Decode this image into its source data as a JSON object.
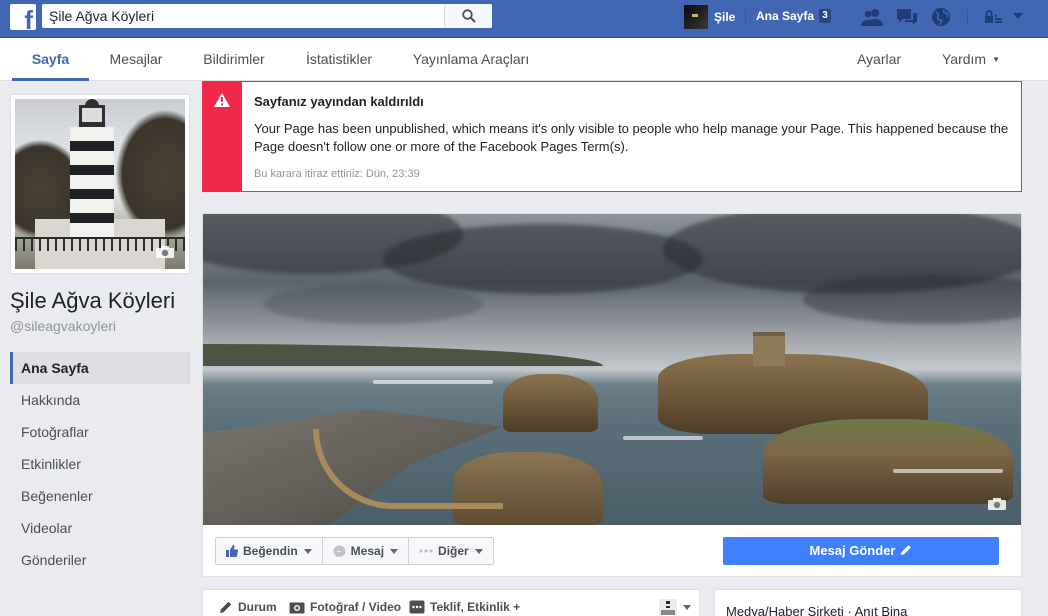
{
  "topbar": {
    "logo_letter": "f",
    "search": {
      "value": "Şile Ağva Köyleri",
      "placeholder": ""
    },
    "profile_name": "Şile",
    "home_label": "Ana Sayfa",
    "home_badge": "3",
    "icons": [
      "friends-icon",
      "messages-icon",
      "globe-icon",
      "lock-icon",
      "chevron-down-icon"
    ],
    "brand_color": "#4267b2"
  },
  "page_nav": {
    "tabs": [
      {
        "label": "Sayfa",
        "active": true
      },
      {
        "label": "Mesajlar"
      },
      {
        "label": "Bildirimler"
      },
      {
        "label": "İstatistikler"
      },
      {
        "label": "Yayınlama Araçları"
      }
    ],
    "right": {
      "settings_label": "Ayarlar",
      "help_label": "Yardım"
    }
  },
  "sidebar": {
    "page_name": "Şile Ağva Köyleri",
    "handle": "@sileagvakoyleri",
    "items": [
      {
        "label": "Ana Sayfa",
        "active": true
      },
      {
        "label": "Hakkında"
      },
      {
        "label": "Fotoğraflar"
      },
      {
        "label": "Etkinlikler"
      },
      {
        "label": "Beğenenler"
      },
      {
        "label": "Videolar"
      },
      {
        "label": "Gönderiler"
      }
    ]
  },
  "alert": {
    "title": "Sayfanız yayından kaldırıldı",
    "body": "Your Page has been unpublished, which means it's only visible to people who help manage your Page. This happened because the Page doesn't follow one or more of the Facebook Pages Term(s).",
    "meta": "Bu karara itiraz ettiniz: Dün, 23:39",
    "color": "#f02849"
  },
  "actions": {
    "like_label": "Beğendin",
    "message_label": "Mesaj",
    "more_label": "Diğer",
    "send_label": "Mesaj Gönder",
    "send_color": "#4080ff"
  },
  "composer": {
    "status_label": "Durum",
    "photo_label": "Fotoğraf / Video",
    "offer_label": "Teklif, Etkinlik +"
  },
  "info": {
    "category": "Medya/Haber Şirketi · Anıt Bina"
  }
}
